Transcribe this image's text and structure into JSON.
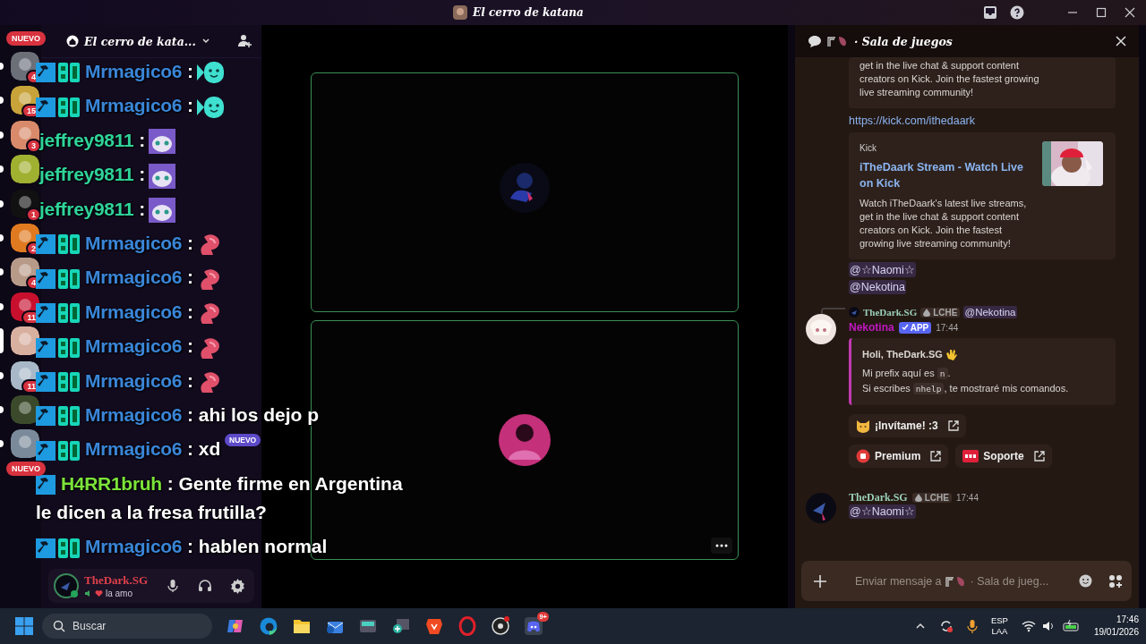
{
  "window": {
    "title": "El cerro de katana"
  },
  "server_rail": {
    "new_badges": [
      "NUEVO",
      "NUEVO"
    ],
    "servers": [
      {
        "count": "4",
        "selected": false
      },
      {
        "count": "15",
        "selected": false
      },
      {
        "count": "3",
        "selected": false
      },
      {
        "selected": false
      },
      {
        "count": "1",
        "selected": false
      },
      {
        "count": "2",
        "selected": false
      },
      {
        "count": "4",
        "selected": false
      },
      {
        "count": "11",
        "selected": false
      },
      {
        "selected": true
      },
      {
        "count": "11",
        "selected": false
      },
      {
        "selected": false
      },
      {
        "selected": false
      }
    ]
  },
  "sidebar": {
    "server_name": "El cerro de kata...",
    "new_badge": "NUEVO",
    "user": {
      "name": "TheDark.SG",
      "status": "la amo"
    }
  },
  "overlay": {
    "messages": [
      {
        "user": "Mrmagico6",
        "color": "#3a86d8",
        "moderator": true,
        "booster": true,
        "text": ":",
        "kind": "ghost"
      },
      {
        "user": "Mrmagico6",
        "color": "#3a86d8",
        "moderator": true,
        "booster": true,
        "text": ":",
        "kind": "ghost"
      },
      {
        "user": "jeffrey9811",
        "color": "#2fd39a",
        "moderator": false,
        "booster": false,
        "text": ":",
        "kind": "cat"
      },
      {
        "user": "jeffrey9811",
        "color": "#2fd39a",
        "moderator": false,
        "booster": false,
        "text": ":",
        "kind": "cat"
      },
      {
        "user": "jeffrey9811",
        "color": "#2fd39a",
        "moderator": false,
        "booster": false,
        "text": ":",
        "kind": "cat"
      },
      {
        "user": "Mrmagico6",
        "color": "#3a86d8",
        "moderator": true,
        "booster": true,
        "text": ":",
        "kind": "creature"
      },
      {
        "user": "Mrmagico6",
        "color": "#3a86d8",
        "moderator": true,
        "booster": true,
        "text": ":",
        "kind": "creature"
      },
      {
        "user": "Mrmagico6",
        "color": "#3a86d8",
        "moderator": true,
        "booster": true,
        "text": ":",
        "kind": "creature"
      },
      {
        "user": "Mrmagico6",
        "color": "#3a86d8",
        "moderator": true,
        "booster": true,
        "text": ":",
        "kind": "creature"
      },
      {
        "user": "Mrmagico6",
        "color": "#3a86d8",
        "moderator": true,
        "booster": true,
        "text": ":",
        "kind": "creature"
      },
      {
        "user": "Mrmagico6",
        "color": "#3a86d8",
        "moderator": true,
        "booster": true,
        "text": ": ahi los dejo p",
        "kind": "text"
      },
      {
        "user": "Mrmagico6",
        "color": "#3a86d8",
        "moderator": true,
        "booster": true,
        "text": ": xd",
        "kind": "text"
      },
      {
        "user": "H4RR1bruh",
        "color": "#7ce33a",
        "moderator": true,
        "booster": false,
        "text": ": Gente firme en Argentina",
        "text_continued": "le dicen a la fresa frutilla?",
        "kind": "text"
      },
      {
        "user": "Mrmagico6",
        "color": "#3a86d8",
        "moderator": true,
        "booster": true,
        "text": ": hablen normal",
        "kind": "text"
      }
    ]
  },
  "panel": {
    "channel": "· Sala de juegos",
    "items": [
      {
        "kind": "embed_tail",
        "text": "get in the live chat & support content creators on Kick. Join the fastest growing live streaming community!"
      },
      {
        "kind": "link",
        "text": "https://kick.com/ithedaark"
      },
      {
        "kind": "embed",
        "provider": "Kick",
        "title": "iTheDaark Stream - Watch Live on Kick",
        "description": "Watch iTheDaark's latest live streams, get in the live chat & support content creators on Kick. Join the fastest growing live streaming community!"
      },
      {
        "kind": "mention",
        "text": "@☆Naomi☆"
      },
      {
        "kind": "mention",
        "text": "@Nekotina"
      },
      {
        "kind": "bot_message",
        "reply": {
          "author": "TheDark.SG",
          "tag": "LCHE",
          "text": "@Nekotina"
        },
        "author": "Nekotina",
        "badge": "APP",
        "time": "17:44",
        "embed": {
          "title": "Holi, TheDark.SG",
          "lines": [
            {
              "before": "Mi prefix aquí es ",
              "code": "n",
              "after": "."
            },
            {
              "before": "Si escribes ",
              "code": "nhelp",
              "after": ", te mostraré mis comandos."
            }
          ]
        },
        "buttons": [
          {
            "label": "¡Invítame! :3",
            "kind": "cat"
          },
          {
            "label": "Premium",
            "kind": "record"
          },
          {
            "label": "Soporte",
            "kind": "sos"
          }
        ]
      },
      {
        "kind": "user_message",
        "author": "TheDark.SG",
        "tag": "LCHE",
        "time": "17:44",
        "mention": "@☆Naomi☆"
      }
    ],
    "input": {
      "placeholder": "Enviar mensaje a",
      "channel": "· Sala de jueg..."
    }
  },
  "taskbar": {
    "search": "Buscar",
    "discord_badge": "9+",
    "lang": [
      "ESP",
      "LAA"
    ],
    "time": "17:46",
    "date": "19/01/2026"
  }
}
